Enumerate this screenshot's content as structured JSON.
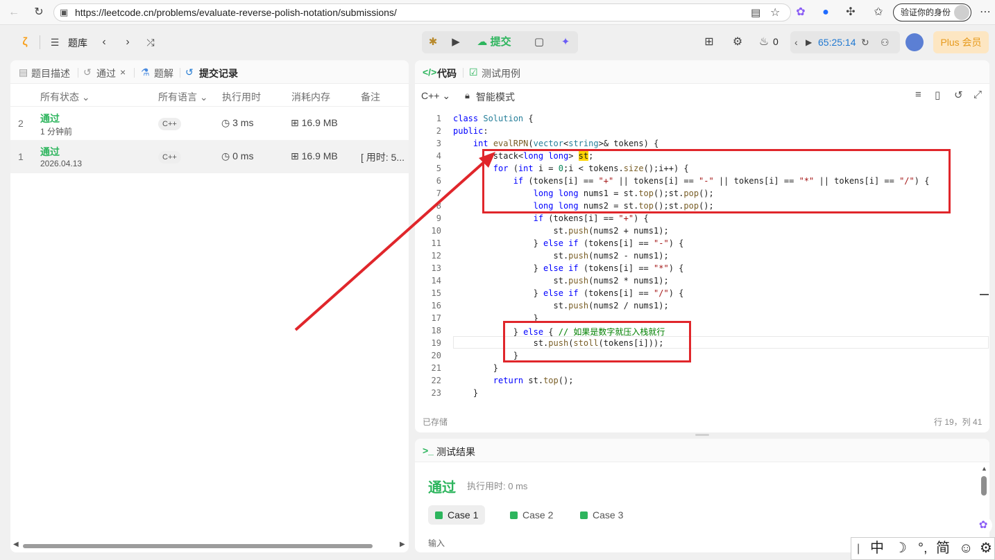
{
  "browser": {
    "url": "https://leetcode.cn/problems/evaluate-reverse-polish-notation/submissions/",
    "verify_label": "验证你的身份"
  },
  "header": {
    "problem_bank": "题库",
    "submit_label": "提交",
    "streak_count": "0",
    "timer": "65:25:14",
    "plus_label": "Plus 会员"
  },
  "left": {
    "tabs": [
      "题目描述",
      "通过",
      "题解",
      "提交记录"
    ],
    "columns": [
      "所有状态",
      "所有语言",
      "执行用时",
      "消耗内存",
      "备注"
    ],
    "rows": [
      {
        "idx": "2",
        "status": "通过",
        "time": "1 分钟前",
        "lang": "C++",
        "runtime": "3 ms",
        "memory": "16.9 MB",
        "note": ""
      },
      {
        "idx": "1",
        "status": "通过",
        "time": "2026.04.13",
        "lang": "C++",
        "runtime": "0 ms",
        "memory": "16.9 MB",
        "note": "[ 用时: 5..."
      }
    ]
  },
  "editor": {
    "tabs": [
      "代码",
      "测试用例"
    ],
    "language": "C++",
    "mode": "智能模式",
    "status_saved": "已存储",
    "cursor_pos": "行 19，列 41",
    "lines": [
      "1",
      "2",
      "3",
      "4",
      "5",
      "6",
      "7",
      "8",
      "9",
      "10",
      "11",
      "12",
      "13",
      "14",
      "15",
      "16",
      "17",
      "18",
      "19",
      "20",
      "21",
      "22",
      "23"
    ]
  },
  "result": {
    "title": "测试结果",
    "status": "通过",
    "runtime_label": "执行用时: 0 ms",
    "cases": [
      "Case 1",
      "Case 2",
      "Case 3"
    ],
    "input_label": "输入"
  },
  "ime": {
    "mode": "中",
    "simplified": "简"
  }
}
